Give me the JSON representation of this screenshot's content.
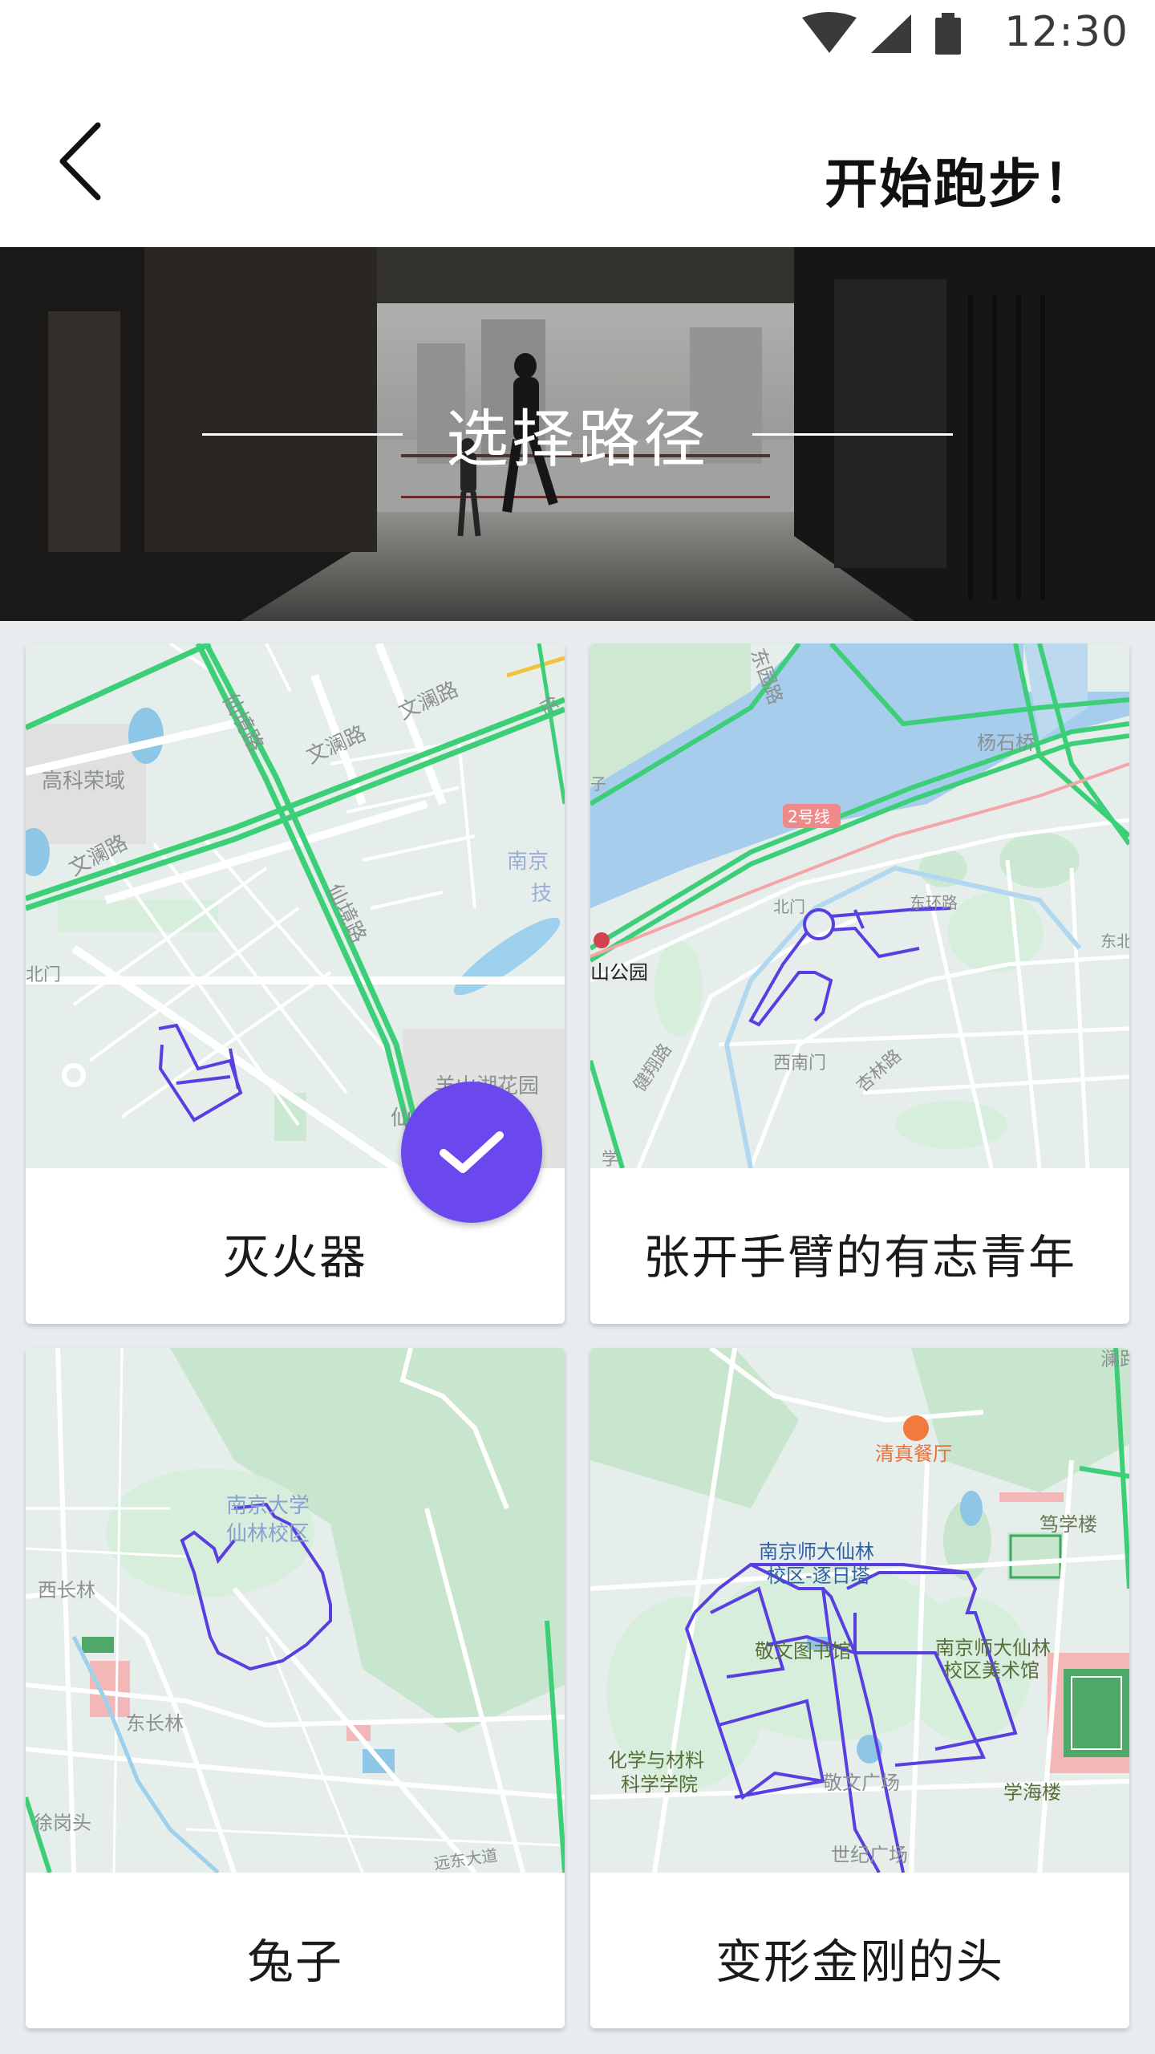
{
  "status_bar": {
    "time": "12:30",
    "icons": [
      "wifi-icon",
      "signal-icon",
      "battery-icon"
    ]
  },
  "header": {
    "title": "开始跑步！",
    "back_icon": "chevron-left-icon"
  },
  "hero": {
    "title": "选择路径"
  },
  "colors": {
    "accent": "#6a48ee",
    "route": "#5a3fe0",
    "map_bg": "#e6eeec",
    "road_green": "#3ccf78"
  },
  "routes": [
    {
      "name": "灭火器",
      "selected": true,
      "map_labels": [
        "高科荣域",
        "文澜路",
        "仙境路",
        "文澜路",
        "文澜路",
        "仙境路",
        "南京",
        "技",
        "北门",
        "羊山湖花园",
        "仙",
        "任"
      ]
    },
    {
      "name": "张开手臂的有志青年",
      "selected": false,
      "map_labels": [
        "东园路",
        "杨石桥",
        "2号线",
        "北门",
        "东环路",
        "山公园",
        "西南门",
        "健翔路",
        "杏林路",
        "东北",
        "学",
        "子"
      ]
    },
    {
      "name": "兔子",
      "selected": false,
      "map_labels": [
        "南京大学",
        "仙林校区",
        "西长林",
        "东长林",
        "徐岗头",
        "远东大道"
      ]
    },
    {
      "name": "变形金刚的头",
      "selected": false,
      "map_labels": [
        "清真餐厅",
        "澜路",
        "笃学楼",
        "南京师大仙林",
        "校区-逐日塔",
        "敬文图书馆",
        "南京师大仙林",
        "校区美术馆",
        "化学与材料",
        "科学学院",
        "敬文广场",
        "学海楼",
        "世纪广场"
      ]
    }
  ],
  "selected_icon": "checkmark-icon"
}
